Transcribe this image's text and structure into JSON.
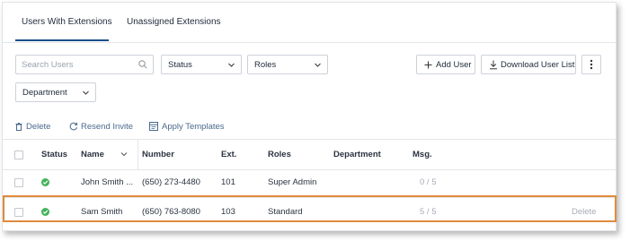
{
  "tabs": [
    {
      "label": "Users With Extensions",
      "active": true
    },
    {
      "label": "Unassigned Extensions",
      "active": false
    }
  ],
  "filters": {
    "search_placeholder": "Search Users",
    "status_label": "Status",
    "roles_label": "Roles",
    "department_label": "Department"
  },
  "toolbar": {
    "add_user": "Add User",
    "download": "Download User List"
  },
  "bulk_actions": {
    "delete": "Delete",
    "resend_invite": "Resend Invite",
    "apply_templates": "Apply Templates"
  },
  "table": {
    "headers": [
      "Status",
      "Name",
      "Number",
      "Ext.",
      "Roles",
      "Department",
      "Msg."
    ],
    "rows": [
      {
        "status": "active",
        "name": "John Smith ...",
        "number": "(650) 273-4480",
        "ext": "101",
        "role": "Super Admin",
        "department": "",
        "msg": "0 / 5",
        "action": ""
      },
      {
        "status": "active",
        "name": "Sam Smith",
        "number": "(650) 763-8080",
        "ext": "103",
        "role": "Standard",
        "department": "",
        "msg": "5 / 5",
        "action": "Delete"
      }
    ]
  },
  "colors": {
    "accent": "#1a4f8b",
    "status_active": "#43b35a",
    "highlight": "#e08a3c",
    "link": "#4a6a8c"
  }
}
